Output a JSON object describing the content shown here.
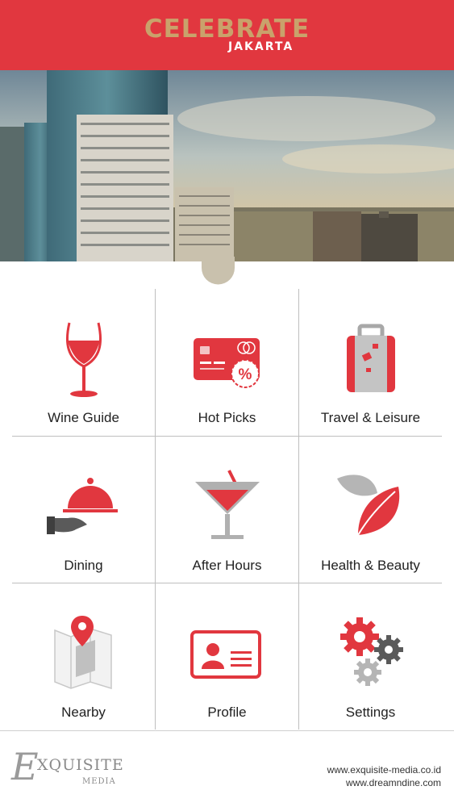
{
  "header": {
    "title": "CELEBRATE",
    "subtitle": "JAKARTA"
  },
  "menu": [
    {
      "label": "Wine Guide",
      "icon": "wine-glass-icon"
    },
    {
      "label": "Hot Picks",
      "icon": "discount-card-icon"
    },
    {
      "label": "Travel & Leisure",
      "icon": "luggage-icon"
    },
    {
      "label": "Dining",
      "icon": "cloche-icon"
    },
    {
      "label": "After Hours",
      "icon": "cocktail-icon"
    },
    {
      "label": "Health & Beauty",
      "icon": "leaf-icon"
    },
    {
      "label": "Nearby",
      "icon": "map-pin-icon"
    },
    {
      "label": "Profile",
      "icon": "id-card-icon"
    },
    {
      "label": "Settings",
      "icon": "gears-icon"
    }
  ],
  "footer": {
    "brand_name": "XQUISITE",
    "brand_initial": "E",
    "brand_sub": "MEDIA",
    "url_1": "www.exquisite-media.co.id",
    "url_2": "www.dreamndine.com"
  },
  "colors": {
    "accent": "#e1373f",
    "gold": "#c9a26b",
    "grey": "#a8a8a8"
  }
}
